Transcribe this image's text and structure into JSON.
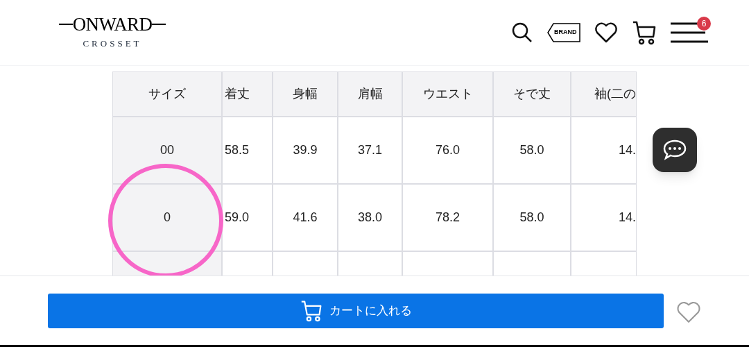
{
  "header": {
    "logo": "ONWARD",
    "sublogo": "CROSSET",
    "brand_tag": "BRAND",
    "menu_badge": "6"
  },
  "size_table": {
    "columns": [
      "サイズ",
      "着丈",
      "身幅",
      "肩幅",
      "ウエスト",
      "そで丈",
      "袖(二の"
    ],
    "rows": [
      [
        "00",
        "58.5",
        "39.9",
        "37.1",
        "76.0",
        "58.0",
        "14."
      ],
      [
        "0",
        "59.0",
        "41.6",
        "38.0",
        "78.2",
        "58.0",
        "14."
      ]
    ]
  },
  "cart_button": {
    "label": "カートに入れる"
  }
}
